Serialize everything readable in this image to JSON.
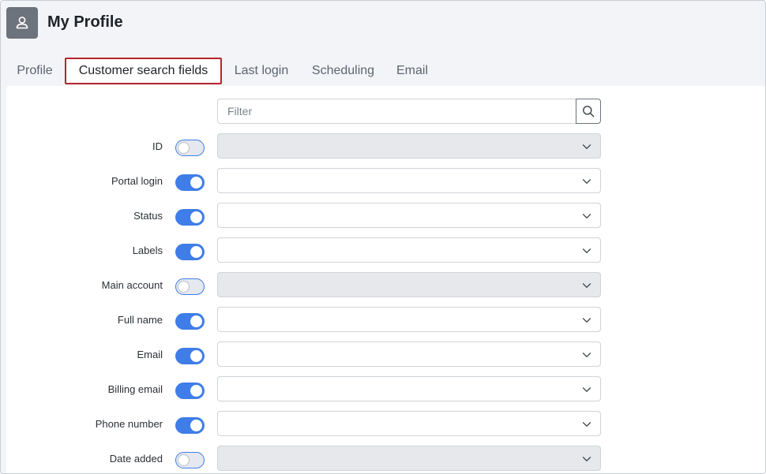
{
  "header": {
    "title": "My Profile",
    "avatar_icon": "user-icon"
  },
  "tabs": [
    {
      "label": "Profile"
    },
    {
      "label": "Customer search fields"
    },
    {
      "label": "Last login"
    },
    {
      "label": "Scheduling"
    },
    {
      "label": "Email"
    }
  ],
  "active_tab": "Customer search fields",
  "filter": {
    "placeholder": "Filter",
    "value": ""
  },
  "fields": [
    {
      "label": "ID",
      "enabled": false
    },
    {
      "label": "Portal login",
      "enabled": true
    },
    {
      "label": "Status",
      "enabled": true
    },
    {
      "label": "Labels",
      "enabled": true
    },
    {
      "label": "Main account",
      "enabled": false
    },
    {
      "label": "Full name",
      "enabled": true
    },
    {
      "label": "Email",
      "enabled": true
    },
    {
      "label": "Billing email",
      "enabled": true
    },
    {
      "label": "Phone number",
      "enabled": true
    },
    {
      "label": "Date added",
      "enabled": false
    }
  ],
  "colors": {
    "accent": "#3f7de8",
    "active_tab_border": "#b3262d"
  }
}
